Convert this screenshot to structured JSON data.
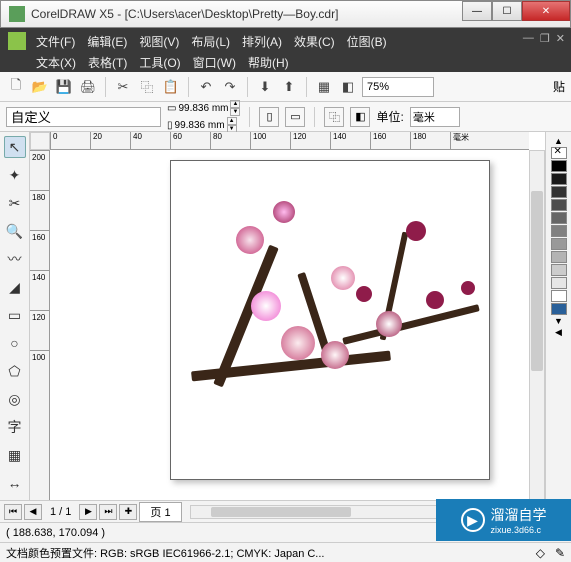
{
  "window": {
    "title": "CorelDRAW X5 - [C:\\Users\\acer\\Desktop\\Pretty—Boy.cdr]"
  },
  "menu": {
    "row1": [
      "文件(F)",
      "编辑(E)",
      "视图(V)",
      "布局(L)",
      "排列(A)",
      "效果(C)",
      "位图(B)"
    ],
    "row2": [
      "文本(X)",
      "表格(T)",
      "工具(O)",
      "窗口(W)",
      "帮助(H)"
    ]
  },
  "toolbar": {
    "zoom": "75%",
    "paste": "贴"
  },
  "properties": {
    "preset": "自定义",
    "width": "99.836 mm",
    "height": "99.836 mm",
    "unit_label": "单位:",
    "unit": "毫米"
  },
  "ruler_h": [
    "0",
    "20",
    "40",
    "60",
    "80",
    "100",
    "120",
    "140",
    "160",
    "180",
    "毫米"
  ],
  "ruler_v": [
    "200",
    "180",
    "160",
    "140",
    "120",
    "100"
  ],
  "palette_colors": [
    "#000000",
    "#1a1a1a",
    "#333333",
    "#4d4d4d",
    "#666666",
    "#808080",
    "#999999",
    "#b3b3b3",
    "#cccccc",
    "#e6e6e6",
    "#ffffff",
    "#2a6099"
  ],
  "pager": {
    "info": "1 / 1",
    "tab": "页 1"
  },
  "status": {
    "coords": "( 188.638, 170.094 )",
    "profile": "文档颜色预置文件: RGB: sRGB IEC61966-2.1; CMYK: Japan C..."
  },
  "watermark": {
    "brand": "溜溜自学",
    "url": "zixue.3d66.c"
  }
}
